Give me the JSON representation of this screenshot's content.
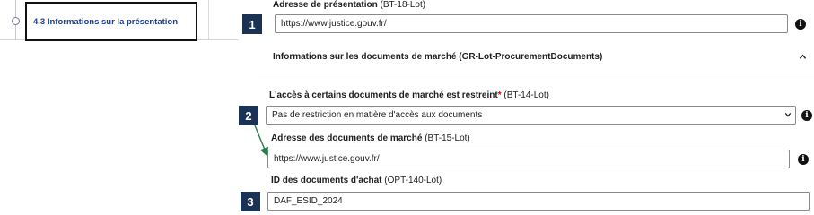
{
  "nav": {
    "item_label": "4.3 Informations sur la présentation"
  },
  "badges": [
    "1",
    "2",
    "3"
  ],
  "fields": {
    "presentation": {
      "label": "Adresse de présentation",
      "code": "(BT-18-Lot)",
      "value": "https://www.justice.gouv.fr/"
    },
    "section": {
      "title": "Informations sur les documents de marché (GR-Lot-ProcurementDocuments)"
    },
    "restriction": {
      "label": "L'accès à certains documents de marché est restreint",
      "required_mark": "*",
      "code": "(BT-14-Lot)",
      "selected": "Pas de restriction en matière d'accès aux documents"
    },
    "documents": {
      "label": "Adresse des documents de marché",
      "code": "(BT-15-Lot)",
      "value": "https://www.justice.gouv.fr/"
    },
    "procurement_id": {
      "label": "ID des documents d'achat",
      "code": "(OPT-140-Lot)",
      "value": "DAF_ESID_2024"
    }
  },
  "info_icon_glyph": "i",
  "colors": {
    "badge_bg": "#1c3255",
    "nav_text": "#1f3f7d",
    "required": "#d0021b",
    "arrow": "#2e7d4f"
  },
  "icons": {
    "info": "info-icon",
    "chevron": "chevron-down-icon",
    "collapse": "chevron-up-icon"
  }
}
